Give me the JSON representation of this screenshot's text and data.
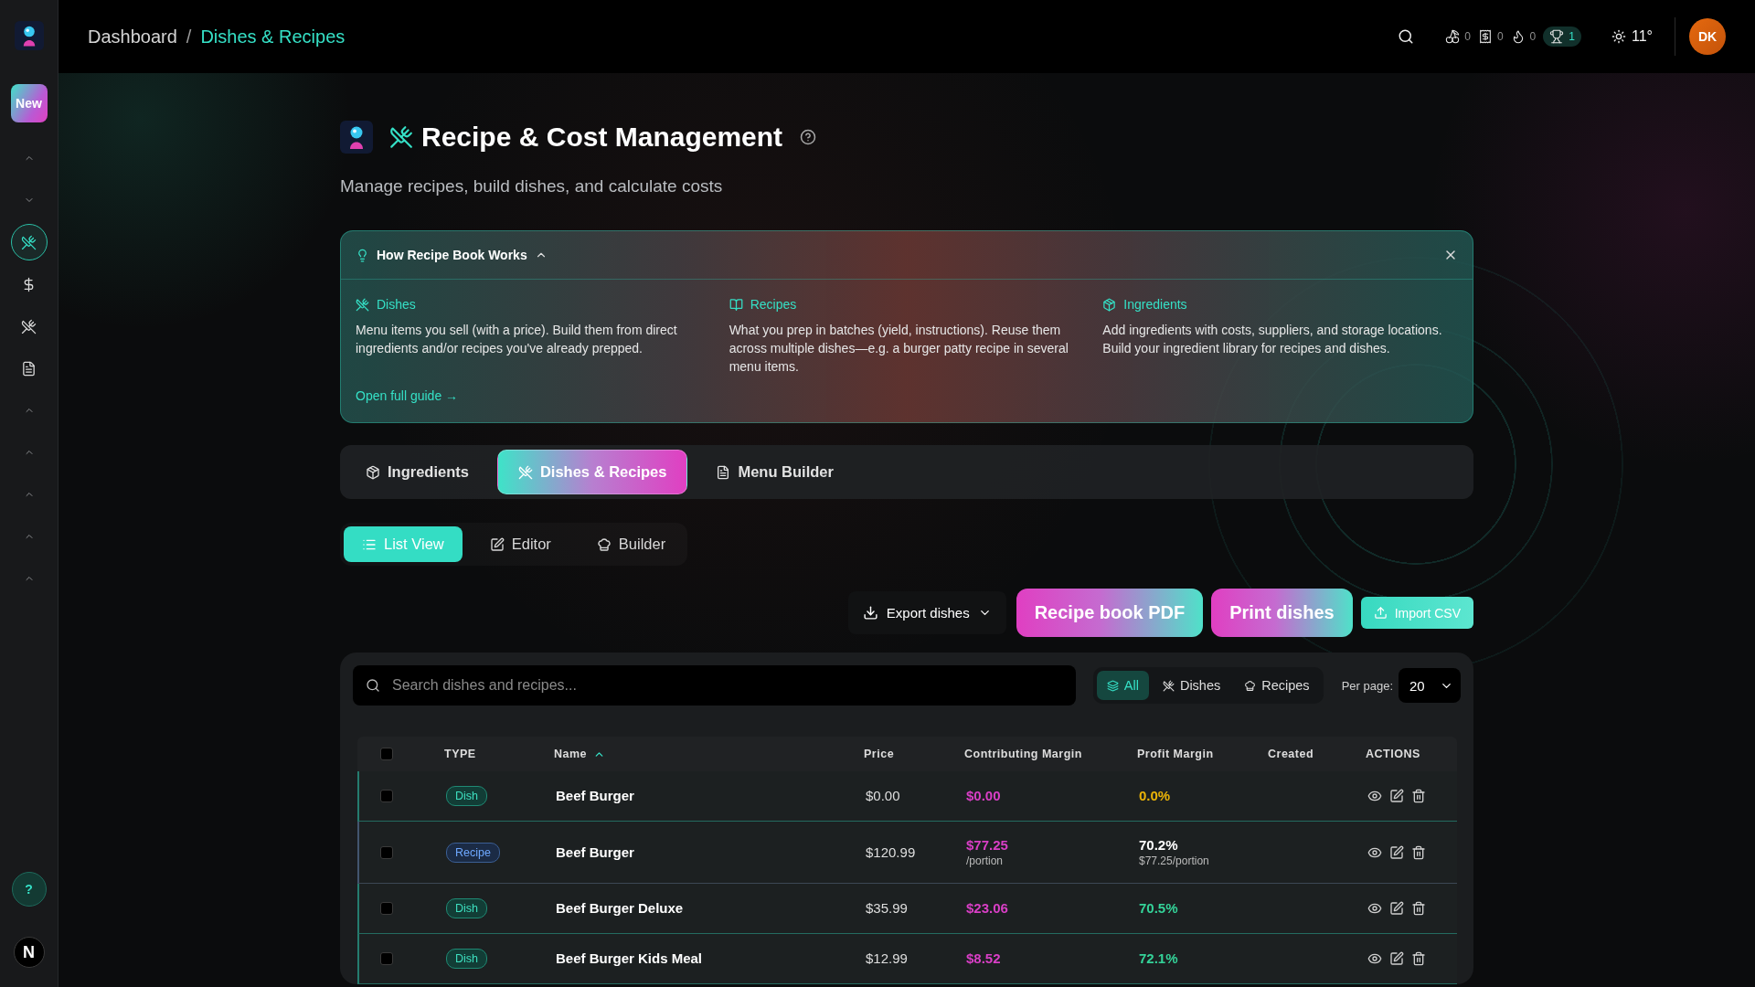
{
  "sidebar": {
    "new_label": "New",
    "items": [
      {
        "kind": "up",
        "selected": false
      },
      {
        "kind": "down",
        "selected": false
      },
      {
        "kind": "utensils",
        "selected": true
      },
      {
        "kind": "dollar",
        "selected": false
      },
      {
        "kind": "utensils",
        "selected": false
      },
      {
        "kind": "document",
        "selected": false
      },
      {
        "kind": "up",
        "selected": false
      },
      {
        "kind": "up",
        "selected": false
      },
      {
        "kind": "up",
        "selected": false
      },
      {
        "kind": "up",
        "selected": false
      },
      {
        "kind": "up",
        "selected": false
      }
    ],
    "help_label": "?",
    "badge_label": "N"
  },
  "topbar": {
    "breadcrumb": [
      {
        "label": "Dashboard",
        "selected": false
      },
      {
        "label": "Dishes & Recipes",
        "selected": true
      }
    ],
    "separator": "/",
    "stats": [
      {
        "count": "0",
        "highlighted": false
      },
      {
        "count": "0",
        "highlighted": false
      },
      {
        "count": "0",
        "highlighted": false
      },
      {
        "count": "1",
        "highlighted": true
      }
    ],
    "temperature": "11°",
    "avatar": "DK"
  },
  "header": {
    "title": "Recipe & Cost Management",
    "subtitle": "Manage recipes, build dishes, and calculate costs"
  },
  "guide": {
    "title": "How Recipe Book Works",
    "expanded": true,
    "sections": [
      {
        "title": "Dishes",
        "text": "Menu items you sell (with a price). Build them from direct ingredients and/or recipes you've already prepped."
      },
      {
        "title": "Recipes",
        "text": "What you prep in batches (yield, instructions). Reuse them across multiple dishes—e.g. a burger patty recipe in several menu items."
      },
      {
        "title": "Ingredients",
        "text": "Add ingredients with costs, suppliers, and storage locations. Build your ingredient library for recipes and dishes."
      }
    ],
    "link": "Open full guide →"
  },
  "module_tabs": [
    {
      "label": "Ingredients",
      "selected": false
    },
    {
      "label": "Dishes & Recipes",
      "selected": true
    },
    {
      "label": "Menu Builder",
      "selected": false
    }
  ],
  "view_tabs": [
    {
      "label": "List View",
      "selected": true
    },
    {
      "label": "Editor",
      "selected": false
    },
    {
      "label": "Builder",
      "selected": false
    }
  ],
  "actions": [
    {
      "kind": "dropdown",
      "label": "Export dishes"
    },
    {
      "kind": "gradient",
      "label": "Recipe book PDF"
    },
    {
      "kind": "gradient",
      "label": "Print dishes"
    },
    {
      "kind": "import",
      "label": "Import CSV"
    }
  ],
  "table": {
    "search_placeholder": "Search dishes and recipes...",
    "filters": [
      {
        "label": "All",
        "selected": true
      },
      {
        "label": "Dishes",
        "selected": false
      },
      {
        "label": "Recipes",
        "selected": false
      }
    ],
    "per_page": {
      "label": "Per page:",
      "value": "20"
    },
    "select_all": {
      "checked": false
    },
    "columns": [
      {
        "label": "TYPE",
        "sorted": false
      },
      {
        "label": "Name",
        "sorted": true
      },
      {
        "label": "Price",
        "sorted": false
      },
      {
        "label": "Contributing Margin",
        "sorted": false
      },
      {
        "label": "Profit Margin",
        "sorted": false
      },
      {
        "label": "Created",
        "sorted": false
      },
      {
        "label": "ACTIONS",
        "sorted": false
      }
    ],
    "rows": [
      {
        "checked": false,
        "kind": "dish",
        "type": "Dish",
        "name": "Beef Burger",
        "price": "$0.00",
        "margin": "$0.00",
        "profit": {
          "text": "0.0%",
          "color": "#eab308"
        }
      },
      {
        "checked": false,
        "kind": "recipe",
        "type": "Recipe",
        "name": "Beef Burger",
        "price": "$120.99",
        "margin": "$77.25",
        "margin_note": "/portion",
        "profit": {
          "text": "70.2%",
          "color": "#ffffff",
          "note": "$77.25/portion"
        }
      },
      {
        "checked": false,
        "kind": "dish",
        "type": "Dish",
        "name": "Beef Burger Deluxe",
        "price": "$35.99",
        "margin": "$23.06",
        "profit": {
          "text": "70.5%",
          "color": "#34d399"
        }
      },
      {
        "checked": false,
        "kind": "dish",
        "type": "Dish",
        "name": "Beef Burger Kids Meal",
        "price": "$12.99",
        "margin": "$8.52",
        "profit": {
          "text": "72.1%",
          "color": "#34d399"
        }
      }
    ]
  }
}
